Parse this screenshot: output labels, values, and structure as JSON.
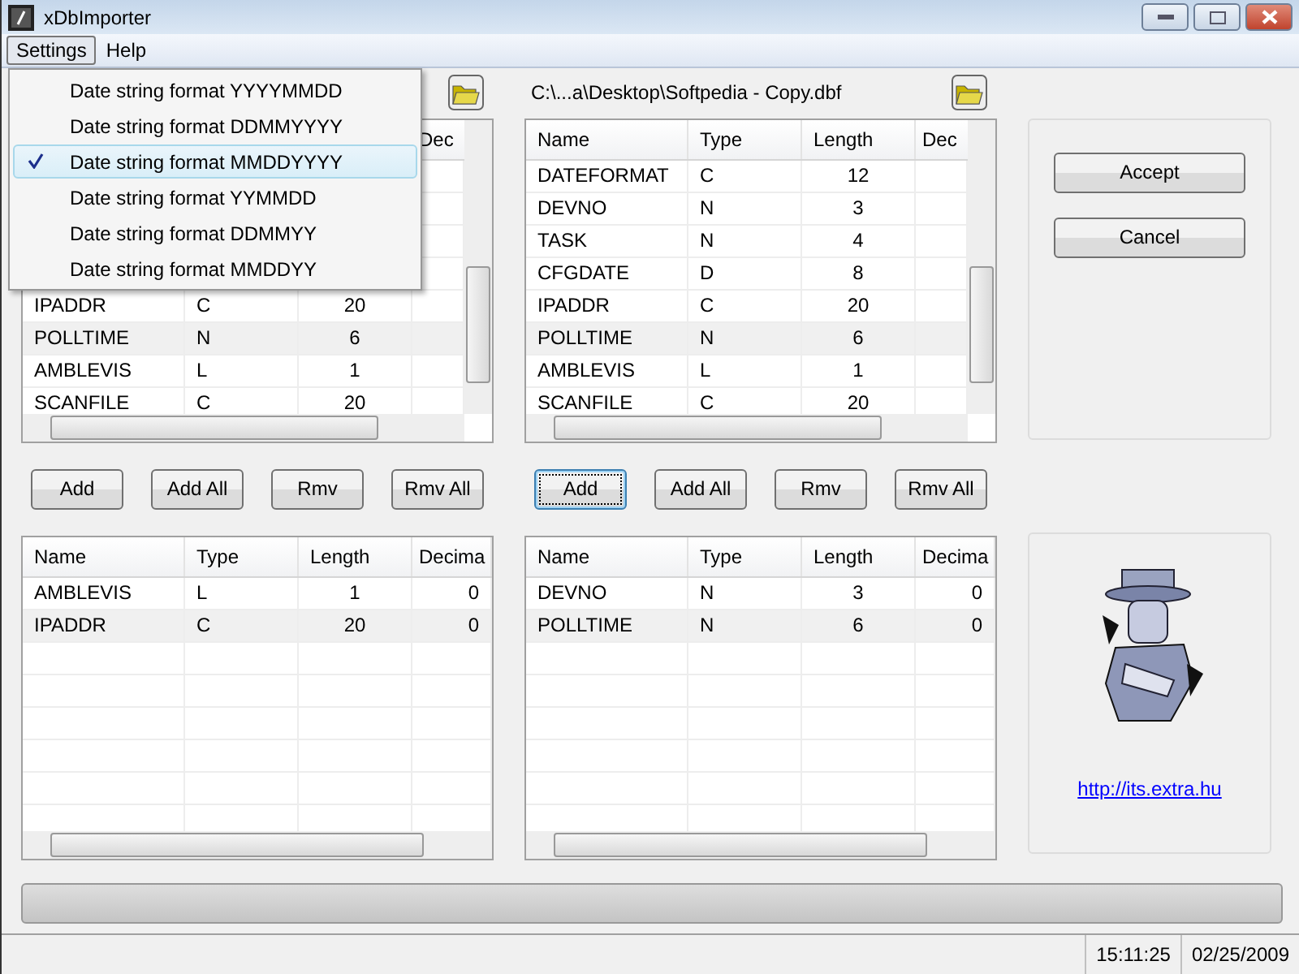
{
  "window": {
    "title": "xDbImporter"
  },
  "menu_bar": [
    {
      "label": "Settings",
      "selected": true
    },
    {
      "label": "Help",
      "selected": false
    }
  ],
  "settings_menu": [
    {
      "label": "Date string format YYYYMMDD",
      "checked": false,
      "selected": false
    },
    {
      "label": "Date string format DDMMYYYY",
      "checked": false,
      "selected": false
    },
    {
      "label": "Date string format MMDDYYYY",
      "checked": true,
      "selected": true
    },
    {
      "label": "Date string format YYMMDD",
      "checked": false,
      "selected": false
    },
    {
      "label": "Date string format DDMMYY",
      "checked": false,
      "selected": false
    },
    {
      "label": "Date string format MMDDYY",
      "checked": false,
      "selected": false
    }
  ],
  "source_left": {
    "columns": [
      "",
      "",
      "",
      "Dec"
    ],
    "rows": [
      {
        "cells": [
          "IPADDR",
          "C",
          "20",
          ""
        ],
        "selected": false
      },
      {
        "cells": [
          "POLLTIME",
          "N",
          "6",
          ""
        ],
        "selected": true
      },
      {
        "cells": [
          "AMBLEVIS",
          "L",
          "1",
          ""
        ],
        "selected": false
      },
      {
        "cells": [
          "SCANFILE",
          "C",
          "20",
          ""
        ],
        "selected": false
      }
    ]
  },
  "source_right": {
    "path": "C:\\...a\\Desktop\\Softpedia - Copy.dbf",
    "columns": [
      "Name",
      "Type",
      "Length",
      "Dec"
    ],
    "rows": [
      {
        "cells": [
          "DATEFORMAT",
          "C",
          "12",
          ""
        ],
        "selected": false
      },
      {
        "cells": [
          "DEVNO",
          "N",
          "3",
          ""
        ],
        "selected": false
      },
      {
        "cells": [
          "TASK",
          "N",
          "4",
          ""
        ],
        "selected": false
      },
      {
        "cells": [
          "CFGDATE",
          "D",
          "8",
          ""
        ],
        "selected": false
      },
      {
        "cells": [
          "IPADDR",
          "C",
          "20",
          ""
        ],
        "selected": false
      },
      {
        "cells": [
          "POLLTIME",
          "N",
          "6",
          ""
        ],
        "selected": true
      },
      {
        "cells": [
          "AMBLEVIS",
          "L",
          "1",
          ""
        ],
        "selected": false
      },
      {
        "cells": [
          "SCANFILE",
          "C",
          "20",
          ""
        ],
        "selected": false
      }
    ]
  },
  "buttons_left": [
    {
      "label": "Add",
      "focused": false
    },
    {
      "label": "Add All",
      "focused": false
    },
    {
      "label": "Rmv",
      "focused": false
    },
    {
      "label": "Rmv All",
      "focused": false
    }
  ],
  "buttons_right": [
    {
      "label": "Add",
      "focused": true
    },
    {
      "label": "Add All",
      "focused": false
    },
    {
      "label": "Rmv",
      "focused": false
    },
    {
      "label": "Rmv All",
      "focused": false
    }
  ],
  "target_left": {
    "columns": [
      "Name",
      "Type",
      "Length",
      "Decima"
    ],
    "rows": [
      {
        "cells": [
          "AMBLEVIS",
          "L",
          "1",
          "0"
        ],
        "selected": false
      },
      {
        "cells": [
          "IPADDR",
          "C",
          "20",
          "0"
        ],
        "selected": true
      }
    ]
  },
  "target_right": {
    "columns": [
      "Name",
      "Type",
      "Length",
      "Decima"
    ],
    "rows": [
      {
        "cells": [
          "DEVNO",
          "N",
          "3",
          "0"
        ],
        "selected": false
      },
      {
        "cells": [
          "POLLTIME",
          "N",
          "6",
          "0"
        ],
        "selected": true
      }
    ]
  },
  "actions": [
    "Accept",
    "Cancel"
  ],
  "link": "http://its.extra.hu",
  "progress": {
    "level": 0
  },
  "status_bar": {
    "time": "15:11:25",
    "date": "02/25/2009"
  }
}
